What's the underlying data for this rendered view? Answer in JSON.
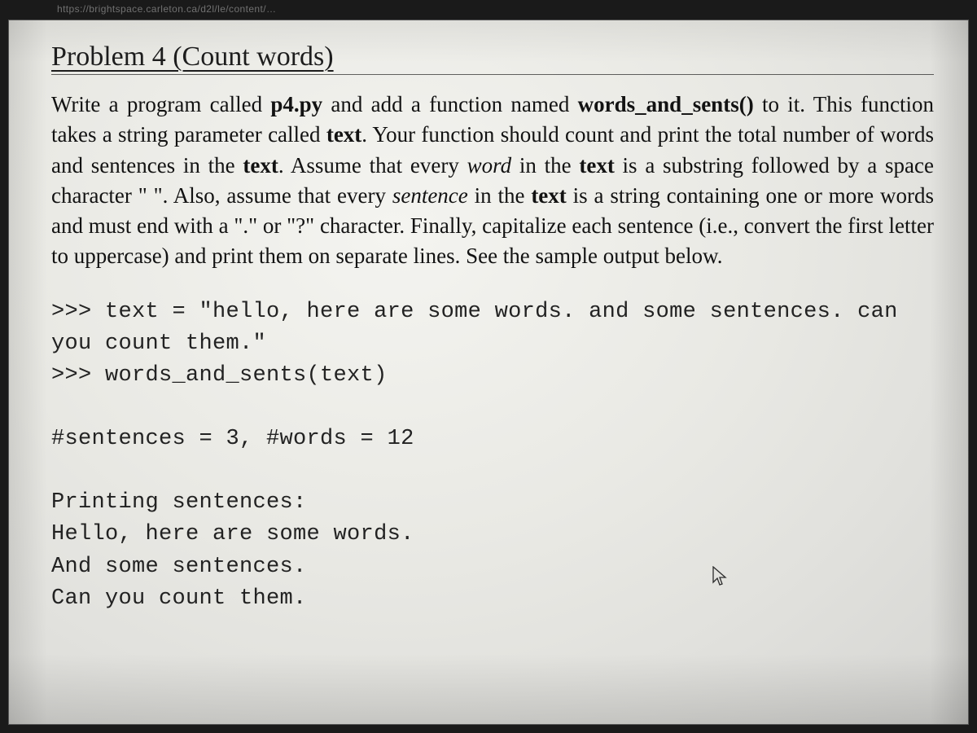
{
  "url_hint": "https://brightspace.carleton.ca/d2l/le/content/…",
  "heading": "Problem 4 (Count words)",
  "body": {
    "p1_a": "Write a program called ",
    "p1_b_file": "p4.py",
    "p1_c": " and add a function named ",
    "p1_d_func": "words_and_sents()",
    "p1_e": " to it. This function takes a string parameter called ",
    "p1_f_text": "text",
    "p1_g": ". Your function should count and print the total number of words and sentences in the ",
    "p1_h_text2": "text",
    "p1_i": ". Assume that every ",
    "p1_j_word": "word",
    "p1_k": " in the ",
    "p1_l_text3": "text",
    "p1_m": " is a substring followed by a space character \" \". Also, assume that every ",
    "p1_n_sentence": "sentence",
    "p1_o": " in the ",
    "p1_p_text4": "text",
    "p1_q": " is a string containing one or more words and must end with a \".\" or \"?\" character. Finally, capitalize each sentence (i.e., convert the first letter to uppercase) and print them on separate lines. See the sample output below."
  },
  "code": {
    "input_line1": ">>> text = \"hello, here are some words. and some sentences. can",
    "input_line2": "you count them.\"",
    "input_line3": ">>> words_and_sents(text)",
    "blank1": "",
    "counts": "#sentences = 3, #words = 12",
    "blank2": "",
    "out_hdr": "Printing sentences:",
    "out_s1": "Hello, here are some words.",
    "out_s2": "And some sentences.",
    "out_s3": "Can you count them."
  }
}
